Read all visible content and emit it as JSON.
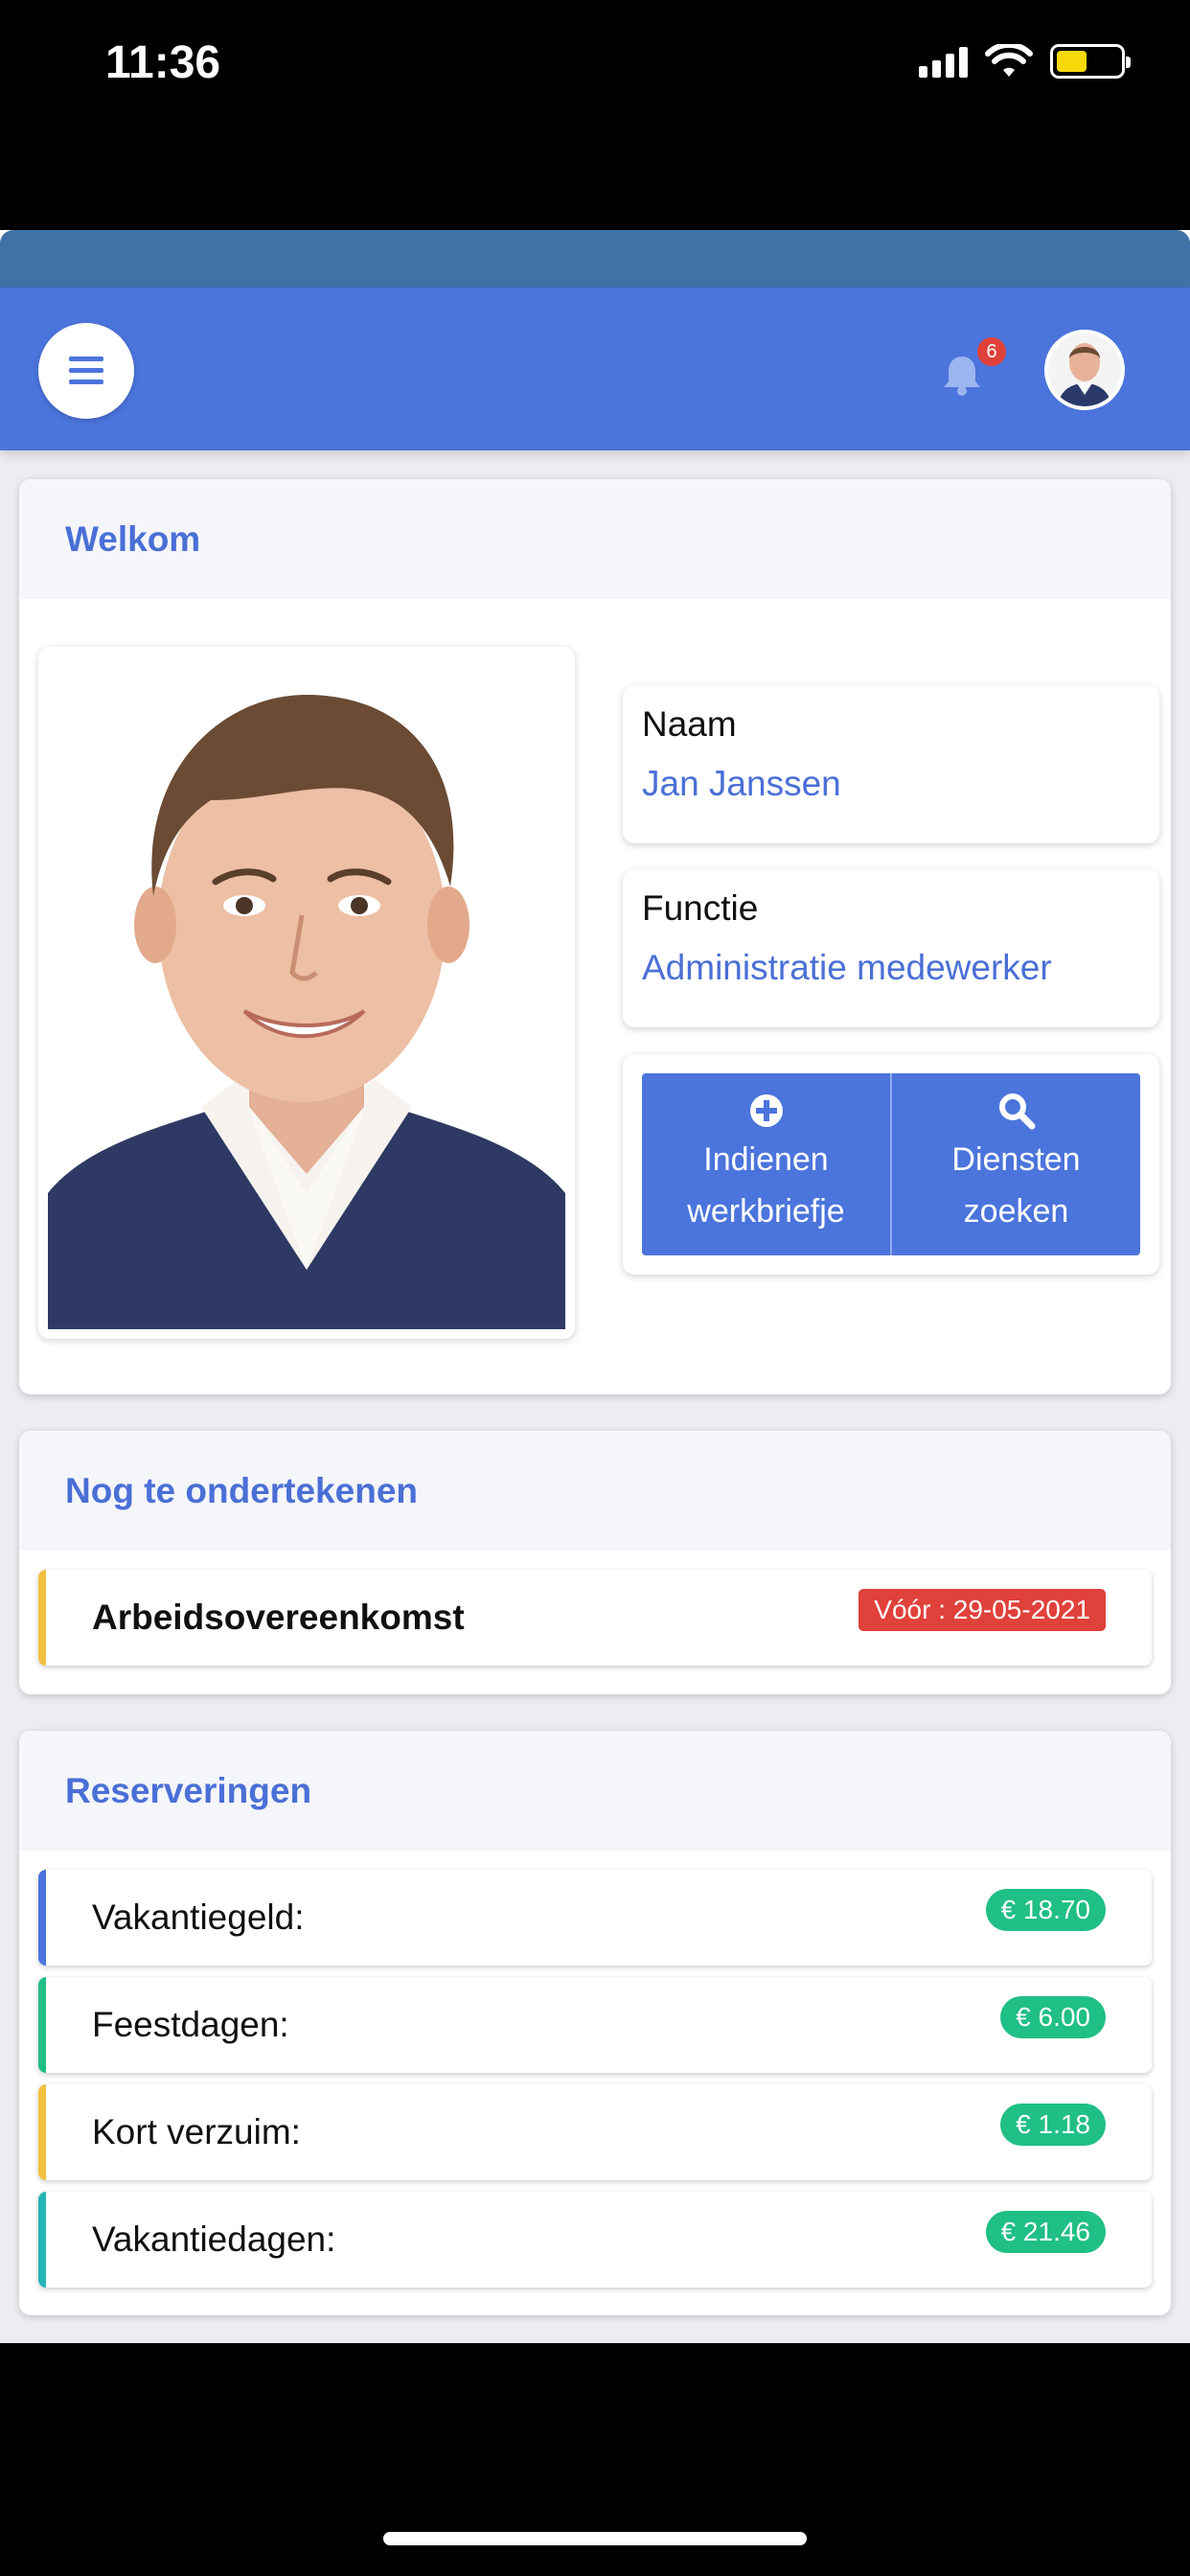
{
  "status_bar": {
    "time": "11:36"
  },
  "header": {
    "notification_count": "6"
  },
  "colors": {
    "primary": "#4b74dc",
    "strip": "#3f72a6",
    "red": "#e0413a",
    "green": "#1fbf85",
    "yellow": "#f2c041",
    "teal": "#26b5b5"
  },
  "welcome": {
    "title": "Welkom",
    "name_label": "Naam",
    "name_value": "Jan Janssen",
    "function_label": "Functie",
    "function_value": "Administratie medewerker",
    "actions": [
      {
        "line1": "Indienen",
        "line2": "werkbriefje",
        "icon": "plus-circle-icon"
      },
      {
        "line1": "Diensten",
        "line2": "zoeken",
        "icon": "search-icon"
      }
    ]
  },
  "to_sign": {
    "title": "Nog te ondertekenen",
    "items": [
      {
        "label": "Arbeidsovereenkomst",
        "deadline": "Vóór : 29-05-2021"
      }
    ]
  },
  "reservations": {
    "title": "Reserveringen",
    "items": [
      {
        "label": "Vakantiegeld:",
        "amount": "€ 18.70",
        "accent": "#4b74dc"
      },
      {
        "label": "Feestdagen:",
        "amount": "€ 6.00",
        "accent": "#1fbf85"
      },
      {
        "label": "Kort verzuim:",
        "amount": "€ 1.18",
        "accent": "#f2c041"
      },
      {
        "label": "Vakantiedagen:",
        "amount": "€ 21.46",
        "accent": "#26b5b5"
      }
    ]
  }
}
